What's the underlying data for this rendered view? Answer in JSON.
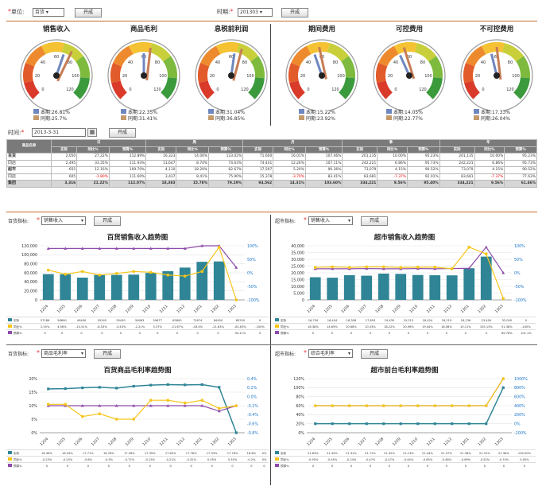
{
  "filters": {
    "unit_label": "单位:",
    "unit_value": "百货",
    "query1": "开成",
    "period_label": "时期:",
    "period_value": "201303",
    "query2": "开成"
  },
  "gauges": [
    {
      "title": "销售收入",
      "needle": 0.62,
      "legend": [
        {
          "label": "本期:26.81%",
          "color": "#6f87bf"
        },
        {
          "label": "同期:25.7%",
          "color": "#c49a6c"
        }
      ]
    },
    {
      "title": "商品毛利",
      "needle": 0.55,
      "legend": [
        {
          "label": "本期:22.35%",
          "color": "#6f87bf"
        },
        {
          "label": "同期:31.41%",
          "color": "#c49a6c"
        }
      ]
    },
    {
      "title": "息税前利润",
      "needle": 0.58,
      "legend": [
        {
          "label": "本期:31.04%",
          "color": "#6f87bf"
        },
        {
          "label": "同期:36.85%",
          "color": "#c49a6c"
        }
      ]
    },
    {
      "title": "期间费用",
      "needle": 0.48,
      "legend": [
        {
          "label": "本期:15.22%",
          "color": "#6f87bf"
        },
        {
          "label": "同期:23.92%",
          "color": "#c49a6c"
        }
      ]
    },
    {
      "title": "可控费用",
      "needle": 0.46,
      "legend": [
        {
          "label": "本期:14.05%",
          "color": "#6f87bf"
        },
        {
          "label": "同期:22.77%",
          "color": "#c49a6c"
        }
      ]
    },
    {
      "title": "不可控费用",
      "needle": 0.5,
      "legend": [
        {
          "label": "本期:17.33%",
          "color": "#6f87bf"
        },
        {
          "label": "同期:26.04%",
          "color": "#c49a6c"
        }
      ]
    }
  ],
  "gauge_ticks": [
    "0",
    "20",
    "40",
    "60",
    "80",
    "100",
    "120"
  ],
  "table_filter": {
    "label": "时间:",
    "value": "2013-3-31",
    "query": "开成"
  },
  "table": {
    "corner": "商品名称",
    "groups": [
      "日",
      "周",
      "月",
      "季",
      "年"
    ],
    "subcols": [
      "实际",
      "同比%",
      "预算%"
    ],
    "rows": [
      {
        "name": "百货",
        "cls": "",
        "cells": [
          "2,050",
          "27.22%",
          "112.89%",
          "16,323",
          "14.06%",
          "133.02%",
          "71,600",
          "16.01%",
          "107.46%",
          "201,135",
          "10.00%",
          "95.23%",
          "201,135",
          "10.00%",
          "95.23%"
        ]
      },
      {
        "name": "同店",
        "cls": "sub",
        "cells": [
          "2,495",
          "33.35%",
          "111.93%",
          "11,647",
          "8.74%",
          "74.63%",
          "74,441",
          "12.26%",
          "107.11%",
          "242,221",
          "6.86%",
          "95.73%",
          "242,221",
          "6.86%",
          "95.73%"
        ]
      },
      {
        "name": "超市",
        "cls": "",
        "cells": [
          "655",
          "12.16%",
          "109.70%",
          "4,110",
          "18.20%",
          "82.67%",
          "17,597",
          "5.20%",
          "90.36%",
          "73,079",
          "4.15%",
          "90.52%",
          "73,079",
          "4.15%",
          "90.52%"
        ]
      },
      {
        "name": "同店",
        "cls": "sub",
        "cells": [
          "605",
          "-1.80%",
          "111.60%",
          "3,437",
          "8.41%",
          "75.90%",
          "15,378",
          "-3.70%",
          "83.41%",
          "83,681",
          "-7.37%",
          "92.01%",
          "83,681",
          "-7.37%",
          "77.63%"
        ]
      },
      {
        "name": "集团",
        "cls": "tot",
        "cells": [
          "3,316",
          "21.22%",
          "112.07%",
          "18,383",
          "15.78%",
          "79.29%",
          "94,562",
          "14.31%",
          "103.60%",
          "334,221",
          "9.56%",
          "95.40%",
          "334,221",
          "9.56%",
          "61.46%"
        ]
      }
    ]
  },
  "panels": [
    {
      "filter_label": "百货指标:",
      "filter_value": "销售收入",
      "query": "开成",
      "title": "百货销售收入趋势图",
      "ylim": [
        0,
        120000
      ],
      "yticks": [
        "0",
        "20,000",
        "40,000",
        "60,000",
        "80,000",
        "100,000",
        "120,000"
      ],
      "y2ticks": [
        "-100%",
        "-50%",
        "0%",
        "50%",
        "100%"
      ],
      "chart_data": {
        "type": "bar",
        "categories": [
          "1204",
          "1205",
          "1206",
          "1207",
          "1208",
          "1209",
          "1210",
          "1211",
          "1212",
          "1301",
          "1302",
          "1303"
        ],
        "series": [
          {
            "name": "实际",
            "values": [
              57186,
              56890,
              49400,
              55245,
              55450,
              56063,
              59677,
              63800,
              71674,
              84450,
              85250,
              0
            ]
          },
          {
            "name": "同比%",
            "values": [
              0.1,
              -0.05,
              0.05,
              -0.08,
              -0.02,
              0.05,
              0.02,
              -0.08,
              -0.12,
              0.05,
              0.95,
              -1.0
            ]
          },
          {
            "name": "预算%",
            "values": [
              0.9,
              0.9,
              0.9,
              0.9,
              0.9,
              0.9,
              0.9,
              0.9,
              0.9,
              1.0,
              1.0,
              0.2
            ]
          }
        ]
      },
      "rows": [
        {
          "label": "实际",
          "vals": [
            "57186",
            "56890",
            "49400",
            "55245",
            "55450",
            "56063",
            "59677",
            "63800",
            "71674",
            "84450",
            "85250",
            "0"
          ]
        },
        {
          "label": "同比%",
          "vals": [
            "2.55%",
            "4.56%",
            "-10.51%",
            "-8.53%",
            "-3.43%",
            "-2.21%",
            "5.37%",
            "-21.67%",
            "-43.4%",
            "-21.63%",
            "-81.63%",
            "-100%"
          ]
        },
        {
          "label": "预算%",
          "vals": [
            "0",
            "0",
            "0",
            "0",
            "0",
            "0",
            "0",
            "0",
            "0",
            "0",
            "94.11%",
            "0"
          ]
        }
      ]
    },
    {
      "filter_label": "超市指标:",
      "filter_value": "销售收入",
      "query": "开成",
      "title": "超市销售收入趋势图",
      "ylim": [
        0,
        40000
      ],
      "yticks": [
        "0",
        "5,000",
        "10,000",
        "15,000",
        "20,000",
        "25,000",
        "30,000",
        "35,000",
        "40,000"
      ],
      "y2ticks": [
        "-100%",
        "-50%",
        "0%",
        "50%",
        "100%"
      ],
      "chart_data": {
        "type": "bar",
        "categories": [
          "1204",
          "1205",
          "1206",
          "1207",
          "1208",
          "1209",
          "1210",
          "1211",
          "1212",
          "1301",
          "1302",
          "1303"
        ],
        "series": [
          {
            "name": "实际",
            "values": [
              16750,
              16404,
              18308,
              17893,
              19435,
              19213,
              18424,
              18219,
              18136,
              23400,
              32000,
              0
            ]
          },
          {
            "name": "同比%",
            "values": [
              0.2,
              0.22,
              0.2,
              0.22,
              0.22,
              0.2,
              0.21,
              0.21,
              0.15,
              0.95,
              0.7,
              -0.95
            ]
          },
          {
            "name": "预算%",
            "values": [
              0.15,
              0.15,
              0.15,
              0.16,
              0.15,
              0.15,
              0.16,
              0.15,
              0.16,
              0.17,
              0.95,
              0
            ]
          }
        ]
      },
      "rows": [
        {
          "label": "实际",
          "vals": [
            "16,750",
            "16,404",
            "18,308",
            "17,893",
            "19,435",
            "19,213",
            "18,424",
            "18,219",
            "18,136",
            "23,400",
            "32,000",
            "0"
          ]
        },
        {
          "label": "同比%",
          "vals": [
            "18.38%",
            "14.69%",
            "20.68%",
            "10.33%",
            "18.22%",
            "20.96%",
            "19.44%",
            "18.58%",
            "10.11%",
            "105.13%",
            "51.38%",
            "-100%"
          ]
        },
        {
          "label": "预算%",
          "vals": [
            "0",
            "0",
            "0",
            "0",
            "0",
            "0",
            "0",
            "0",
            "0",
            "0",
            "89.76%",
            "101.1%"
          ]
        }
      ]
    },
    {
      "filter_label": "百货指标:",
      "filter_value": "商品毛利率",
      "query": "开成",
      "title": "百货商品毛利率趋势图",
      "ylim": [
        0,
        0.2
      ],
      "yticks": [
        "0%",
        "5%",
        "10%",
        "15%",
        "20%"
      ],
      "y2ticks": [
        "-0.8%",
        "-0.6%",
        "-0.4%",
        "-0.2%",
        "0.0%",
        "0.2%",
        "0.4%"
      ],
      "chart_data": {
        "type": "line",
        "categories": [
          "1204",
          "1205",
          "1206",
          "1207",
          "1208",
          "1209",
          "1210",
          "1211",
          "1212",
          "1301",
          "1302",
          "1303"
        ],
        "series": [
          {
            "name": "实际",
            "values": [
              0.162,
              0.163,
              0.166,
              0.168,
              0.165,
              0.172,
              0.176,
              0.178,
              0.177,
              0.178,
              0.168,
              0
            ]
          },
          {
            "name": "同比%",
            "values": [
              0.05,
              0.05,
              -0.4,
              -0.3,
              -0.5,
              -0.5,
              0.2,
              0.2,
              0.1,
              0.2,
              -0.1,
              0.0
            ]
          },
          {
            "name": "预算%",
            "values": [
              0.0,
              0.0,
              0.0,
              0.0,
              0.0,
              0.0,
              0.0,
              0.0,
              0.0,
              0.0,
              -0.2,
              0.0
            ]
          }
        ]
      },
      "rows": [
        {
          "label": "实际",
          "vals": [
            "16.36%",
            "16.34%",
            "17.71%",
            "16.76%",
            "17.26%",
            "17.39%",
            "17.65%",
            "17.78%",
            "17.33%",
            "17.78%",
            "16.8%",
            "0%"
          ]
        },
        {
          "label": "同比%",
          "vals": [
            "-0.23%",
            "-0.25%",
            "-0.6%",
            "-0.5%",
            "-0.72%",
            "-0.15%",
            "-0.21%",
            "-0.32%",
            "0.05%",
            "0.33%",
            "-0.2%",
            "0%"
          ]
        },
        {
          "label": "预算%",
          "vals": [
            "0",
            "0",
            "0",
            "0",
            "0",
            "0",
            "0",
            "0",
            "0",
            "0",
            "0",
            "0"
          ]
        }
      ]
    },
    {
      "filter_label": "超市指标:",
      "filter_value": "综合毛利率",
      "query": "开成",
      "title": "超市前台毛利率趋势图",
      "ylim": [
        0,
        1.2
      ],
      "yticks": [
        "0%",
        "20%",
        "40%",
        "60%",
        "80%",
        "100%",
        "120%"
      ],
      "y2ticks": [
        "-200%",
        "0%",
        "200%",
        "400%",
        "600%",
        "800%",
        "1000%"
      ],
      "chart_data": {
        "type": "line",
        "categories": [
          "1204",
          "1205",
          "1206",
          "1207",
          "1208",
          "1209",
          "1210",
          "1211",
          "1212",
          "1301",
          "1302",
          "1303"
        ],
        "series": [
          {
            "name": "实际",
            "values": [
              0.2,
              0.2,
              0.2,
              0.2,
              0.2,
              0.2,
              0.2,
              0.2,
              0.2,
              0.2,
              0.2,
              1.0
            ]
          },
          {
            "name": "同比%",
            "values": [
              0.0,
              0.0,
              0.0,
              0.0,
              0.0,
              0.0,
              0.0,
              0.0,
              0.0,
              0.0,
              0.0,
              9.0
            ]
          },
          {
            "name": "预算%",
            "values": [
              0.0,
              0.0,
              0.0,
              0.0,
              0.0,
              0.0,
              0.0,
              0.0,
              0.0,
              0.0,
              0.0,
              9.5
            ]
          }
        ]
      },
      "rows": [
        {
          "label": "实际",
          "vals": [
            "21.83%",
            "21.34%",
            "21.31%",
            "21.71%",
            "21.32%",
            "21.13%",
            "21.44%",
            "21.37%",
            "21.36%",
            "21.31%",
            "21.36%",
            "100.00%"
          ]
        },
        {
          "label": "同比%",
          "vals": [
            "-0.95%",
            "-0.45%",
            "-0.24%",
            "-0.47%",
            "-0.47%",
            "-0.44%",
            "-0.65%",
            "-0.48%",
            "-0.69%",
            "-0.52%",
            "-0.74%",
            "0.00%"
          ]
        },
        {
          "label": "预算%",
          "vals": [
            "0",
            "0",
            "0",
            "0",
            "0",
            "0",
            "0",
            "0",
            "0",
            "0",
            "0",
            "0"
          ]
        }
      ]
    }
  ]
}
